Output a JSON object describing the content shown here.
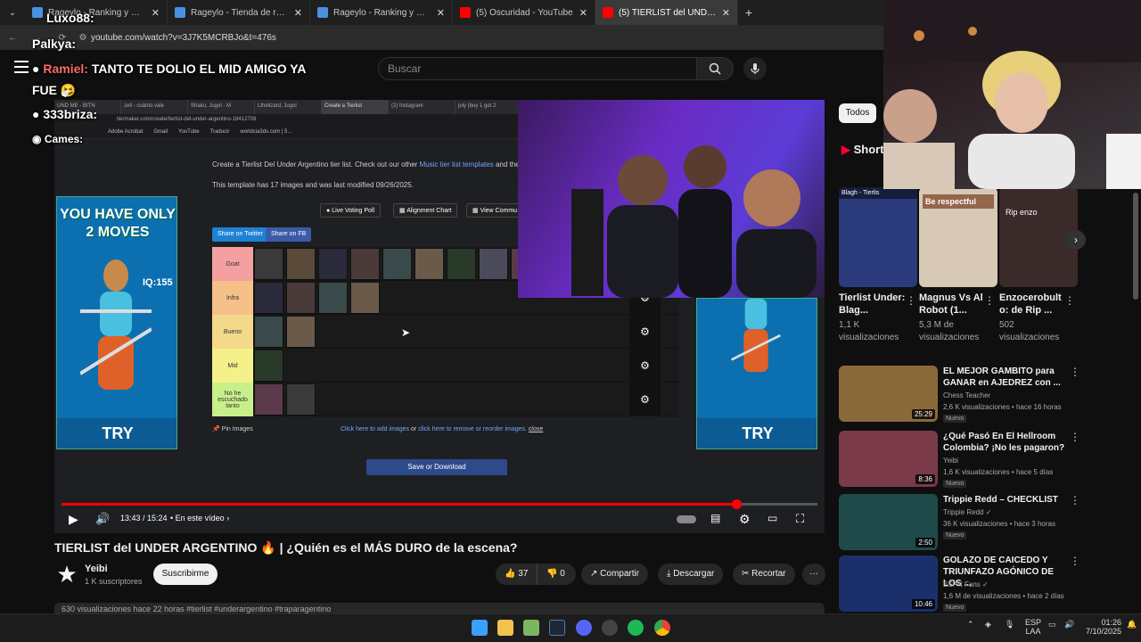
{
  "browser": {
    "tabs": [
      {
        "label": "Rageylo - Ranking y Racha de s",
        "color": "#4a90e2"
      },
      {
        "label": "Rageylo - Tienda de recompen",
        "color": "#4a90e2"
      },
      {
        "label": "Rageylo - Ranking y Racha de s",
        "color": "#4a90e2"
      },
      {
        "label": "(5) Oscuridad - YouTube",
        "color": "#ff0000"
      },
      {
        "label": "(5) TIERLIST del UNDER ARGEN",
        "color": "#ff0000"
      }
    ],
    "new_tab_label": "+",
    "url": "youtube.com/watch?v=3J7K5MCRBJo&t=476s"
  },
  "youtube": {
    "search_placeholder": "Buscar",
    "video_title": "TIERLIST del UNDER ARGENTINO 🔥 | ¿Quién es el MÁS DURO de la escena?",
    "channel_name": "Yeibi",
    "channel_subs": "1 K suscriptores",
    "subscribe_label": "Suscribirme",
    "likes": "37",
    "dislikes": "0",
    "share_label": "Compartir",
    "download_label": "Descargar",
    "clip_label": "Recortar",
    "more_label": "···",
    "description_peek": "630 visualizaciones  hace 22 horas  #tierlist #underargentino #traparagentino",
    "time_current": "13:43",
    "time_total": "15:24",
    "time_display": "13:43 / 15:24",
    "chapter_label": "• En este vídeo ›",
    "progress": 0.893
  },
  "chat": [
    {
      "user": "Luxo88:",
      "message": ""
    },
    {
      "user": "Palkya:",
      "message": ""
    },
    {
      "user": "Ramiel:",
      "message": "TANTO TE DOLIO EL MID AMIGO YA"
    },
    {
      "user": "",
      "message": "FUE 🤧"
    },
    {
      "user": "333briza:",
      "message": ""
    },
    {
      "user": "Cames:",
      "message": ""
    }
  ],
  "player_content": {
    "inner_tabs": [
      "UND ME - BITN",
      "zell - cuánto vale",
      "Shako, Jugol - M",
      "Lthelizard, Jugol",
      "Create a Tierlist",
      "(2) Instagram",
      "july (buy 1 get 2"
    ],
    "inner_url": "tiermaker.com/create/tierlist-del-under-argentino-18412708",
    "bookmarks": [
      "Adobe Acrobat",
      "Gmail",
      "YouTube",
      "Traducir",
      "worldcia3ds.com | 5..."
    ],
    "desc_line1": "Create a Tierlist Del Under Argentino tier list. Check out our other",
    "desc_link": "Music tier list templates",
    "desc_line1_end": "and the mos",
    "desc_line2": "This template has 17 images and was last modified 09/26/2025.",
    "live_voting": "Live Voting Poll",
    "alignment_chart": "Alignment Chart",
    "view_community": "View Commu",
    "share_twitter": "Share on Twitter",
    "share_fb": "Share on FB",
    "tiers": [
      {
        "label": "Goat",
        "color": "#f4a0a0",
        "count": 9
      },
      {
        "label": "Infra",
        "color": "#f5c08a",
        "count": 4
      },
      {
        "label": "Bueno",
        "color": "#f5d98a",
        "count": 2
      },
      {
        "label": "Mid",
        "color": "#f5f08a",
        "count": 1
      },
      {
        "label": "No he escuchado tanto",
        "color": "#c8f08a",
        "count": 2
      }
    ],
    "pin_images": "Pin Images",
    "add_images_text": "Click here to add images",
    "or_text": "or",
    "remove_text": "click here to remove or reorder images.",
    "close_text": "close",
    "save_download": "Save or Download",
    "ad_title": "YOU HAVE ONLY 2 MOVES",
    "ad_iq": "IQ:155",
    "ad_try": "TRY"
  },
  "sidebar": {
    "chip_all": "Todos",
    "shorts_label": "Shorts",
    "shorts": [
      {
        "title": "Tierlist Under: Blag...",
        "views": "1,1 K visualizaciones",
        "color": "#2b3a7a",
        "overlay": "Blagh - Tierlis"
      },
      {
        "title": "Magnus Vs Al Robot (1...",
        "views": "5,3 M de visualizaciones",
        "color": "#d8c9b6",
        "overlay": "Be respectful"
      },
      {
        "title": "Enzocerobult o: de Rip ...",
        "views": "502 visualizaciones",
        "color": "#3a2a2a",
        "overlay": "Rip enzo"
      }
    ],
    "recommendations": [
      {
        "title": "EL MEJOR GAMBITO para GANAR en AJEDREZ con ...",
        "channel": "Chess Teacher",
        "meta": "2,6 K visualizaciones • hace 16 horas",
        "badge": "Nuevo",
        "duration": "25:29",
        "color": "#8a6a3a"
      },
      {
        "title": "¿Qué Pasó En El Hellroom Colombia? ¡No les pagaron?",
        "channel": "Yeibi",
        "meta": "1,6 K visualizaciones • hace 5 días",
        "badge": "Nuevo",
        "duration": "8:36",
        "color": "#7a3a4a"
      },
      {
        "title": "Trippie Redd – CHECKLIST",
        "channel": "Trippie Redd ✓",
        "meta": "36 K visualizaciones • hace 3 horas",
        "badge": "Nuevo",
        "duration": "2:50",
        "color": "#1f4a4a"
      },
      {
        "title": "GOLAZO DE CAICEDO Y TRIUNFAZO AGÓNICO DE LOS ...",
        "channel": "ESPN Fans ✓",
        "meta": "1,6 M de visualizaciones • hace 2 días",
        "badge": "Nuevo",
        "duration": "10:46",
        "color": "#1b2f6a"
      }
    ]
  },
  "taskbar": {
    "lang_line1": "ESP",
    "lang_line2": "LAA",
    "time": "01:26",
    "date": "7/10/2025"
  }
}
